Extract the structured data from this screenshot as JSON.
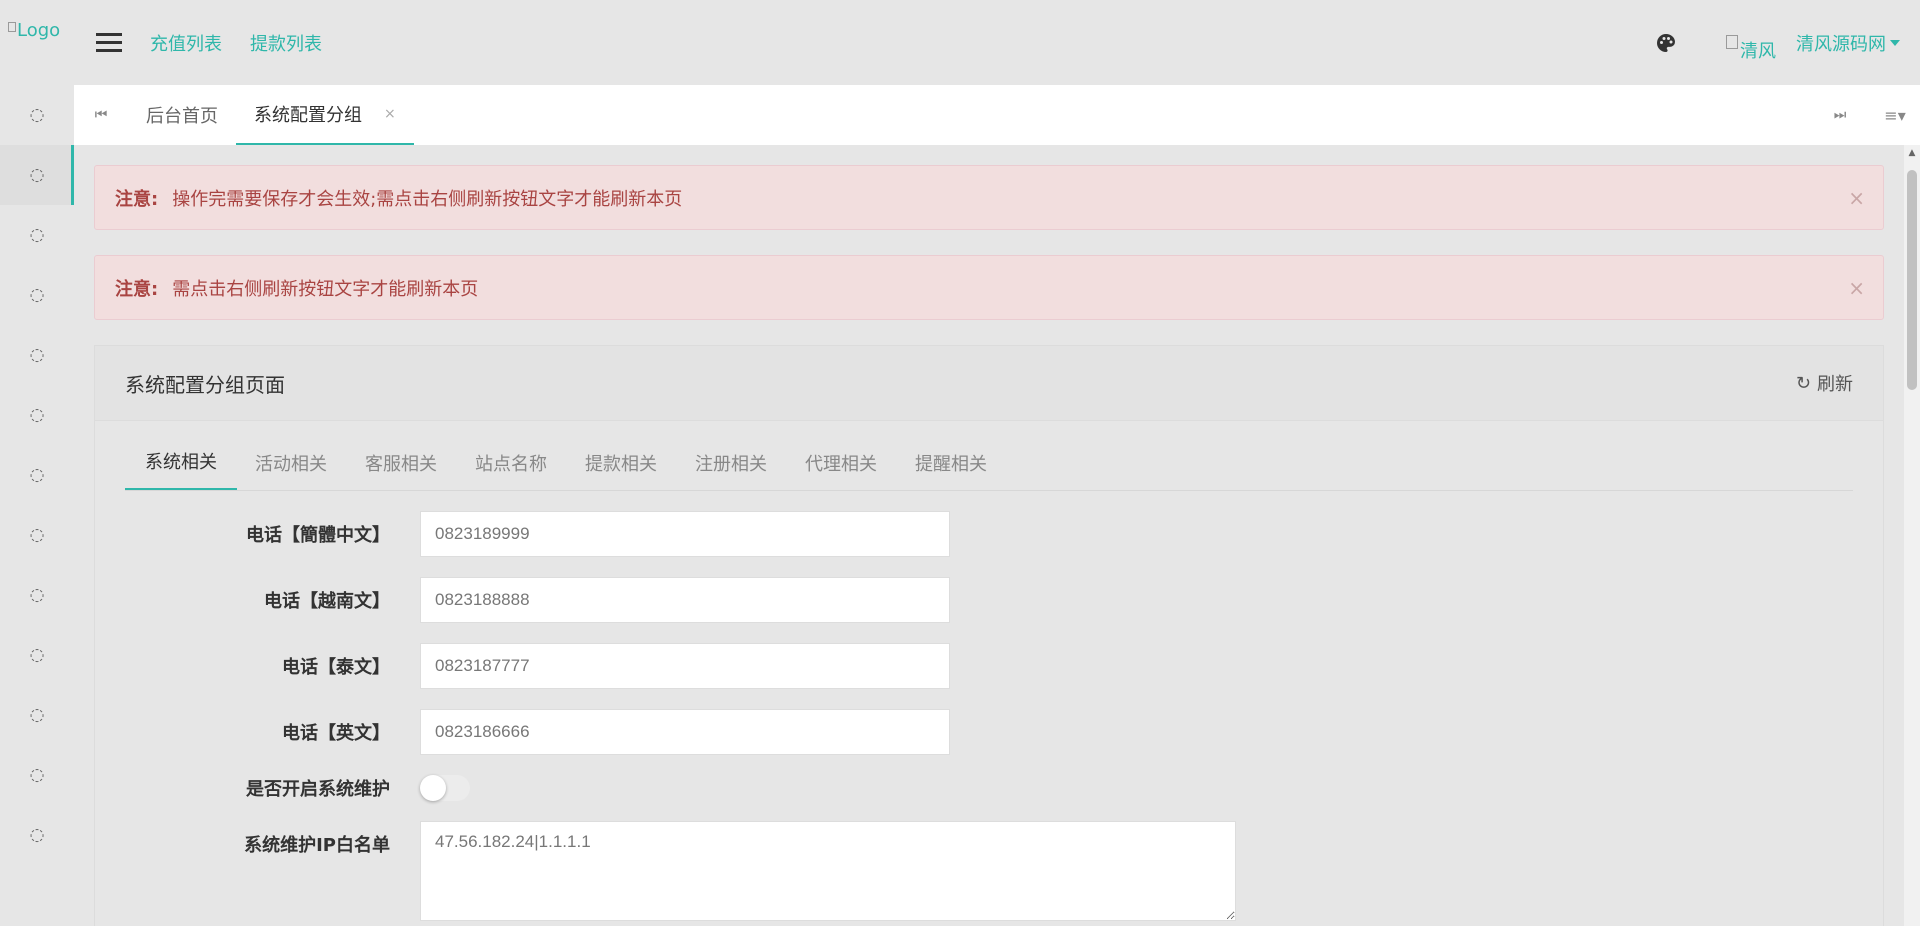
{
  "logo_alt": "Logo",
  "sidebar": {
    "items": [
      "",
      "",
      "",
      "",
      "",
      "",
      "",
      "",
      "",
      "",
      "",
      "",
      ""
    ],
    "icon": "circle-icon"
  },
  "header": {
    "links": [
      "充值列表",
      "提款列表"
    ],
    "avatar_alt": "清风",
    "user_name": "清风源码网"
  },
  "tabs": {
    "items": [
      {
        "label": "后台首页",
        "active": false
      },
      {
        "label": "系统配置分组",
        "active": true,
        "close": "×"
      }
    ]
  },
  "alerts": [
    {
      "label": "注意:",
      "text": "操作完需要保存才会生效;需点击右侧刷新按钮文字才能刷新本页",
      "close": "×"
    },
    {
      "label": "注意:",
      "text": "需点击右侧刷新按钮文字才能刷新本页",
      "close": "×"
    }
  ],
  "panel": {
    "title": "系统配置分组页面",
    "refresh_label": "刷新",
    "subtabs": [
      "系统相关",
      "活动相关",
      "客服相关",
      "站点名称",
      "提款相关",
      "注册相关",
      "代理相关",
      "提醒相关"
    ],
    "active_subtab": 0
  },
  "form": {
    "phone_cn_label": "电话【簡體中文】",
    "phone_cn_value": "0823189999",
    "phone_vn_label": "电话【越南文】",
    "phone_vn_value": "0823188888",
    "phone_th_label": "电话【泰文】",
    "phone_th_value": "0823187777",
    "phone_en_label": "电话【英文】",
    "phone_en_value": "0823186666",
    "maintenance_label": "是否开启系统维护",
    "maintenance_on": false,
    "whitelist_label": "系统维护IP白名单",
    "whitelist_value": "47.56.182.24|1.1.1.1"
  }
}
